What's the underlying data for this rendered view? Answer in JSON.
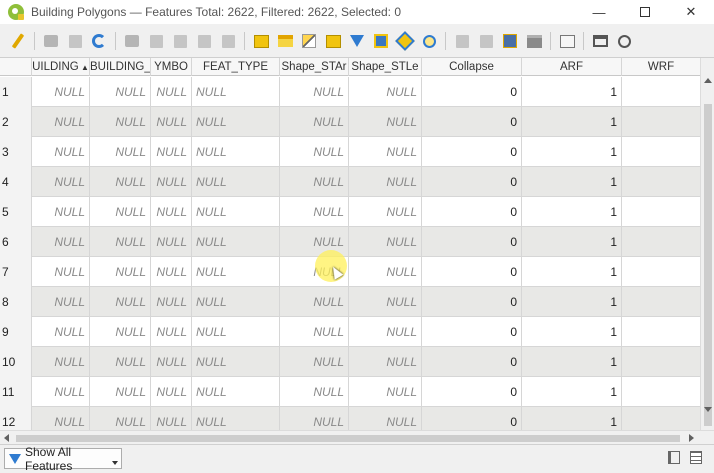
{
  "window": {
    "title": "Building Polygons — Features Total: 2622, Filtered: 2622, Selected: 0",
    "minimize": "—",
    "close": "✕"
  },
  "toolbar": {
    "icons": [
      "toggle-editing-icon",
      "multi-edit-icon",
      "save-edits-icon",
      "reload-icon",
      "add-feature-icon",
      "delete-feature-icon",
      "cut-icon",
      "copy-icon",
      "paste-icon",
      "select-expression-icon",
      "select-all-icon",
      "invert-selection-icon",
      "deselect-icon",
      "filter-select-icon",
      "move-selection-top-icon",
      "pan-to-selection-icon",
      "zoom-to-selection-icon",
      "new-field-icon",
      "delete-field-icon",
      "edit-field-icon",
      "field-calculator-icon",
      "conditional-formatting-icon",
      "dock-toggle-icon",
      "actions-icon"
    ]
  },
  "table": {
    "columns": [
      "UILDING",
      "BUILDING_",
      "YMBO",
      "FEAT_TYPE",
      "Shape_STAr",
      "Shape_STLe",
      "Collapse",
      "ARF",
      "WRF"
    ],
    "null_text": "NULL",
    "rows": [
      {
        "n": "1",
        "collapse": "0",
        "arf": "1"
      },
      {
        "n": "2",
        "collapse": "0",
        "arf": "1"
      },
      {
        "n": "3",
        "collapse": "0",
        "arf": "1"
      },
      {
        "n": "4",
        "collapse": "0",
        "arf": "1"
      },
      {
        "n": "5",
        "collapse": "0",
        "arf": "1"
      },
      {
        "n": "6",
        "collapse": "0",
        "arf": "1"
      },
      {
        "n": "7",
        "collapse": "0",
        "arf": "1"
      },
      {
        "n": "8",
        "collapse": "0",
        "arf": "1"
      },
      {
        "n": "9",
        "collapse": "0",
        "arf": "1"
      },
      {
        "n": "10",
        "collapse": "0",
        "arf": "1"
      },
      {
        "n": "11",
        "collapse": "0",
        "arf": "1"
      },
      {
        "n": "12",
        "collapse": "0",
        "arf": "1"
      }
    ]
  },
  "bottombar": {
    "filter_label": "Show All Features"
  },
  "colors": {
    "row_alt": "#e8e8e6",
    "accent": "#2f7bd0",
    "cursor_highlight": "#fff05a"
  }
}
